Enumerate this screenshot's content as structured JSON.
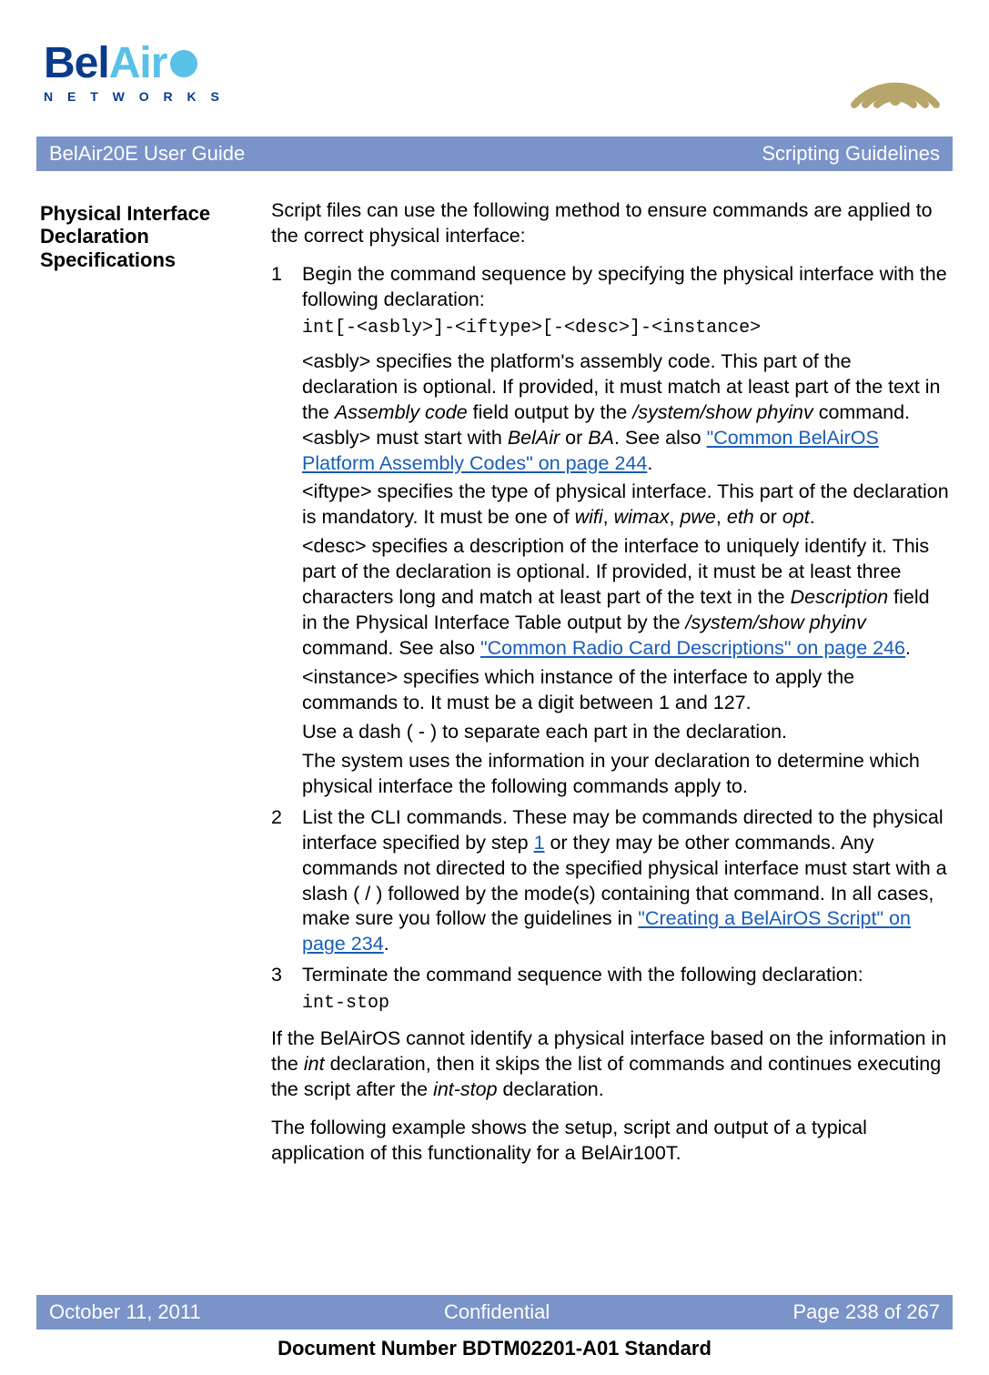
{
  "logo": {
    "part1": "Bel",
    "part2": "Air",
    "sub": "N E T W O R K S"
  },
  "header": {
    "left": "BelAir20E User Guide",
    "right": "Scripting Guidelines"
  },
  "sidebar": {
    "title": "Physical Interface Declaration Specifications"
  },
  "intro": "Script files can use the following method to ensure commands are applied to the correct physical interface:",
  "step1": {
    "num": "1",
    "lead": "Begin the command sequence by specifying the physical interface with the following declaration:",
    "code": "int[-<asbly>]-<iftype>[-<desc>]-<instance>",
    "asbly_a": "<asbly> specifies the platform's assembly code. This part of the declaration is optional. If provided, it must match at least part of the text in the ",
    "asbly_ital1": "Assembly code",
    "asbly_b": " field output by the ",
    "asbly_ital2": "/system/show phyinv",
    "asbly_c": " command. <asbly> must start with ",
    "asbly_ital3": "BelAir",
    "asbly_d": " or ",
    "asbly_ital4": "BA",
    "asbly_e": ". See also ",
    "asbly_link": "\"Common BelAirOS Platform Assembly Codes\" on page 244",
    "asbly_f": ".",
    "iftype_a": "<iftype> specifies the type of physical interface. This part of the declaration is mandatory. It must be one of ",
    "iftype_w": "wifi",
    "iftype_c1": ", ",
    "iftype_wm": "wimax",
    "iftype_c2": ", ",
    "iftype_p": "pwe",
    "iftype_c3": ", ",
    "iftype_e": "eth",
    "iftype_c4": " or ",
    "iftype_o": "opt",
    "iftype_end": ".",
    "desc_a": "<desc> specifies a description of the interface to uniquely identify it. This part of the declaration is optional. If provided, it must be at least three characters long and match at least part of the text in the ",
    "desc_ital1": "Description",
    "desc_b": " field in the Physical Interface Table output by the ",
    "desc_ital2": "/system/show phyinv",
    "desc_c": " command. See also ",
    "desc_link": "\"Common Radio Card Descriptions\" on page 246",
    "desc_d": ".",
    "instance": "<instance> specifies which instance of the interface to apply the commands to. It must be a digit between 1 and 127.",
    "dash": "Use a dash ( - ) to separate each part in the declaration.",
    "sysuse": "The system uses the information in your declaration to determine which physical interface the following commands apply to."
  },
  "step2": {
    "num": "2",
    "a": "List the CLI commands. These may be commands directed to the physical interface specified by step ",
    "link1": "1",
    "b": " or they may be other commands. Any commands not directed to the specified physical interface must start with a slash ( / ) followed by the mode(s) containing that command. In all cases, make sure you follow the guidelines in ",
    "link2": "\"Creating a BelAirOS Script\" on page 234",
    "c": "."
  },
  "step3": {
    "num": "3",
    "lead": "Terminate the command sequence with the following declaration:",
    "code": "int-stop"
  },
  "after_a": "If the BelAirOS cannot identify a physical interface based on the information in the ",
  "after_ital1": "int",
  "after_b": " declaration, then it skips the list of commands and continues executing the script after the ",
  "after_ital2": "int-stop",
  "after_c": " declaration.",
  "example": "The following example shows the setup, script and output of a typical application of this functionality for a BelAir100T.",
  "footer": {
    "left": "October 11, 2011",
    "center": "Confidential",
    "right": "Page 238 of 267"
  },
  "docnum": "Document Number BDTM02201-A01 Standard"
}
